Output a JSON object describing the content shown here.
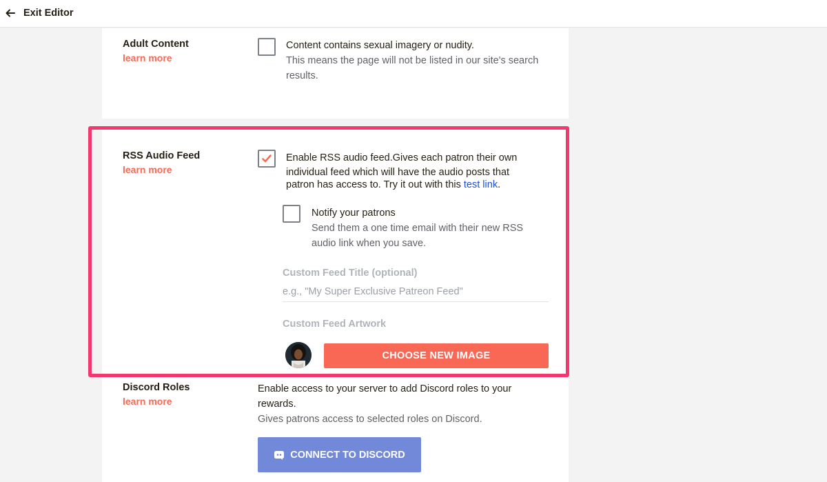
{
  "topbar": {
    "exit_label": "Exit Editor"
  },
  "adult_content": {
    "title": "Adult Content",
    "learn_more": "learn more",
    "checkbox_label": "Content contains sexual imagery or nudity.",
    "description_line1": "This means the page will not be listed in our site's search",
    "description_line2": "results.",
    "checked": false
  },
  "rss": {
    "title": "RSS Audio Feed",
    "learn_more": "learn more",
    "checked": true,
    "enable_line1": "Enable RSS audio feed.Gives each patron their own",
    "enable_line2": "individual feed which will have the audio posts that",
    "enable_line3_prefix": "patron has access to. Try it out with this ",
    "test_link": "test link",
    "enable_line3_suffix": ".",
    "notify": {
      "label": "Notify your patrons",
      "desc_line1": "Send them a one time email with their new RSS",
      "desc_line2": "audio link when you save.",
      "checked": false
    },
    "custom_title_label": "Custom Feed Title (optional)",
    "custom_title_placeholder": "e.g., \"My Super Exclusive Patreon Feed\"",
    "custom_title_value": "",
    "artwork_label": "Custom Feed Artwork",
    "choose_button": "CHOOSE NEW IMAGE"
  },
  "discord": {
    "title": "Discord Roles",
    "learn_more": "learn more",
    "desc_line1": "Enable access to your server to add Discord roles to your",
    "desc_line2": "rewards.",
    "desc_line3": "Gives patrons access to selected roles on Discord.",
    "connect_button": "CONNECT TO DISCORD"
  },
  "colors": {
    "accent": "#f96854",
    "highlight": "#f1386f",
    "discord": "#7289da",
    "link": "#1d4fd7"
  },
  "icons": [
    "arrow-left-icon",
    "checkmark-icon",
    "discord-icon"
  ]
}
